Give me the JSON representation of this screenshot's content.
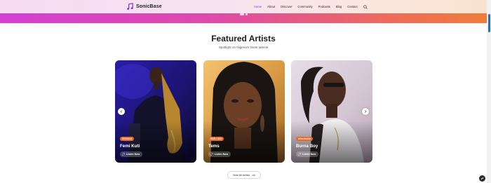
{
  "brand": {
    "name": "SonicBase",
    "icon": "music-note-icon"
  },
  "nav": {
    "items": [
      {
        "label": "Home",
        "active": true
      },
      {
        "label": "About",
        "active": false
      },
      {
        "label": "Discover",
        "active": false
      },
      {
        "label": "Community",
        "active": false
      },
      {
        "label": "Podcasts",
        "active": false
      },
      {
        "label": "Blog",
        "active": false
      },
      {
        "label": "Contact",
        "active": false
      }
    ],
    "search_icon": "search-icon"
  },
  "hero": {
    "slides": 2,
    "active_slide": 1
  },
  "featured": {
    "title": "Featured Artists",
    "subtitle": "Spotlight on Nigeria's finest talents",
    "cards": [
      {
        "genre": "Afrobeat",
        "name": "Femi Kuti",
        "listen_label": "Listen Now"
      },
      {
        "genre": "R&B / Alte",
        "name": "Tems",
        "listen_label": "Listen Now"
      },
      {
        "genre": "Afro-fusion",
        "name": "Burna Boy",
        "listen_label": "Listen Now"
      }
    ],
    "view_all_label": "View All Artists"
  },
  "colors": {
    "accent": "#8e3fd6",
    "genre_badge": "#ea6a26",
    "hero_start": "#d43fd5",
    "hero_end": "#f07d3a"
  }
}
